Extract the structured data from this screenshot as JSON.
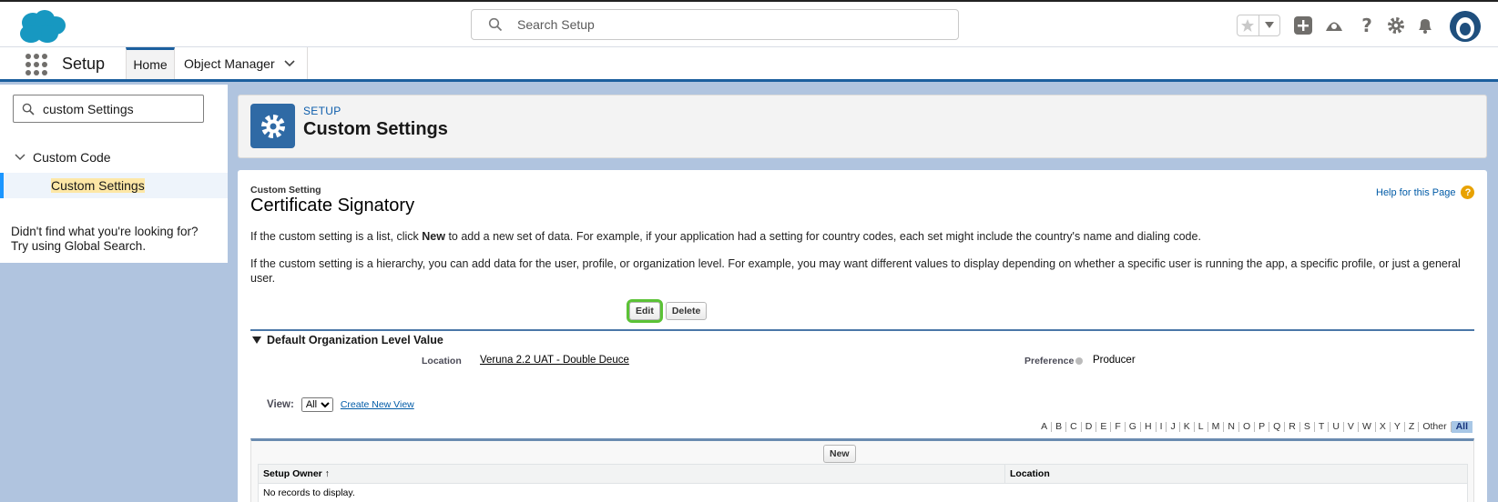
{
  "header": {
    "search_placeholder": "Search Setup"
  },
  "nav": {
    "app_name": "Setup",
    "tabs": [
      {
        "label": "Home"
      },
      {
        "label": "Object Manager"
      }
    ]
  },
  "sidebar": {
    "quickfind_value": "custom Settings",
    "tree": {
      "parent": "Custom Code",
      "child": "Custom Settings"
    },
    "not_found_line1": "Didn't find what you're looking for?",
    "not_found_line2": "Try using Global Search."
  },
  "page_header": {
    "kicker": "SETUP",
    "title": "Custom Settings"
  },
  "detail": {
    "kicker": "Custom Setting",
    "title": "Certificate Signatory",
    "help_link": "Help for this Page",
    "para1_a": "If the custom setting is a list, click ",
    "para1_bold": "New",
    "para1_b": " to add a new set of data. For example, if your application had a setting for country codes, each set might include the country's name and dialing code.",
    "para2": "If the custom setting is a hierarchy, you can add data for the user, profile, or organization level. For example, you may want different values to display depending on whether a specific user is running the app, a specific profile, or just a general user.",
    "edit_label": "Edit",
    "delete_label": "Delete",
    "section_title": "Default Organization Level Value",
    "fields": {
      "location_label": "Location",
      "location_value": "Veruna 2.2 UAT - Double Deuce",
      "preference_label": "Preference",
      "preference_value": "Producer"
    },
    "view_label": "View:",
    "view_selected": "All",
    "create_view": "Create New View",
    "alphabet": [
      "A",
      "B",
      "C",
      "D",
      "E",
      "F",
      "G",
      "H",
      "I",
      "J",
      "K",
      "L",
      "M",
      "N",
      "O",
      "P",
      "Q",
      "R",
      "S",
      "T",
      "U",
      "V",
      "W",
      "X",
      "Y",
      "Z",
      "Other",
      "All"
    ],
    "new_label": "New",
    "table": {
      "columns": [
        "Setup Owner ↑",
        "Location"
      ],
      "empty_text": "No records to display."
    }
  },
  "colors": {
    "brand_blue": "#1b5f9e",
    "page_bg": "#b0c4df",
    "focus_green": "#5bc236"
  }
}
